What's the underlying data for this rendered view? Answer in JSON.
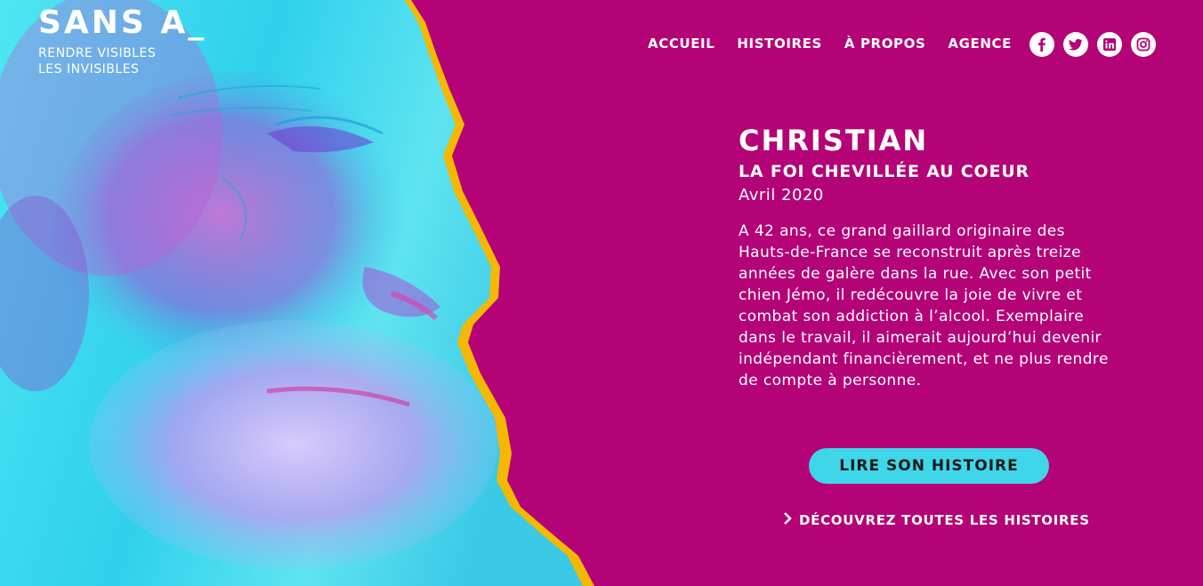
{
  "logo": {
    "title": "SANS A_",
    "tagline_line1": "RENDRE VISIBLES",
    "tagline_line2": "LES INVISIBLES"
  },
  "nav": {
    "items": [
      {
        "label": "ACCUEIL"
      },
      {
        "label": "HISTOIRES"
      },
      {
        "label": "À PROPOS"
      },
      {
        "label": "AGENCE"
      }
    ]
  },
  "social": {
    "icons": [
      "facebook-icon",
      "twitter-icon",
      "linkedin-icon",
      "instagram-icon"
    ]
  },
  "story": {
    "name": "CHRISTIAN",
    "subtitle": "LA FOI CHEVILLÉE AU COEUR",
    "date": "Avril 2020",
    "text": "A 42 ans, ce grand gaillard originaire des Hauts-de-France se reconstruit après treize années de galère dans la rue. Avec son petit chien Jémo, il redécouvre la joie de vivre et combat son addiction à l’alcool. Exemplaire dans le travail, il aimerait aujourd’hui devenir indépendant financièrement, et ne plus rendre de compte à personne."
  },
  "cta": {
    "label": "LIRE SON HISTOIRE"
  },
  "all_stories": {
    "label": "DÉCOUVREZ TOUTES LES HISTOIRES"
  },
  "colors": {
    "background": "#b40277",
    "cyan": "#3fd6ea",
    "outline": "#f5b800",
    "text": "#ffffff"
  }
}
